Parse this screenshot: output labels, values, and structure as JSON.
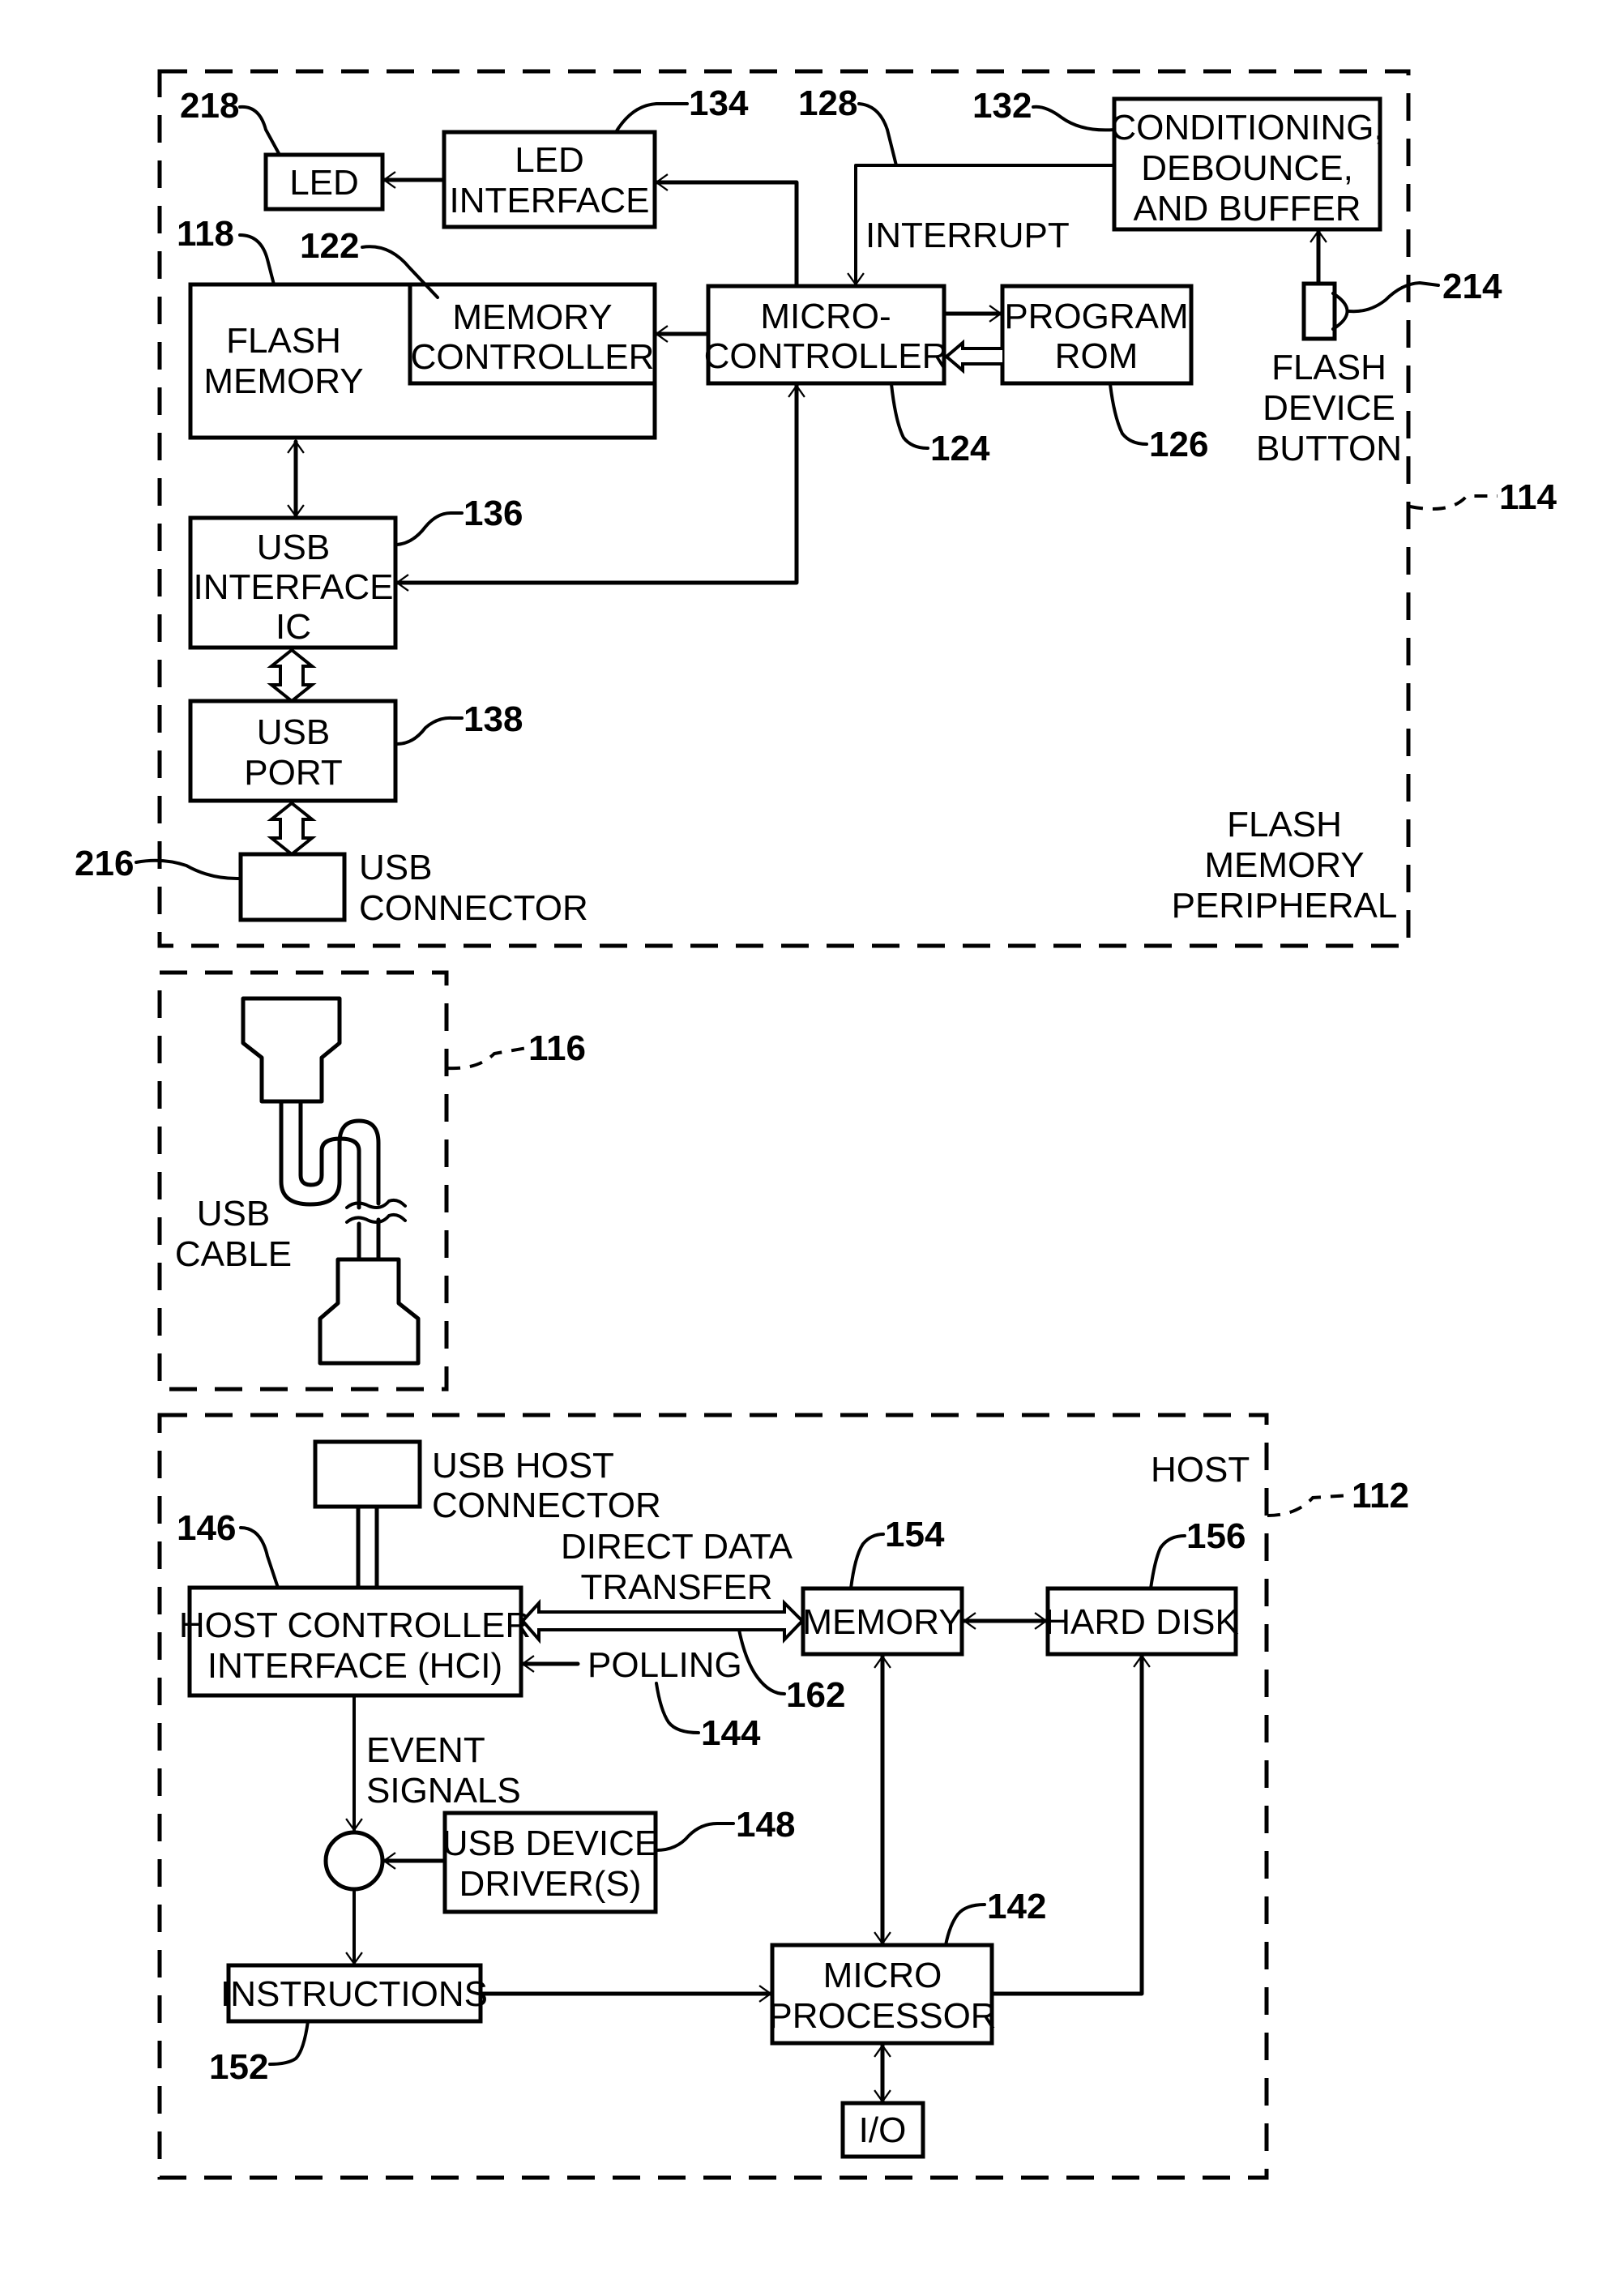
{
  "figure": {
    "flash_peripheral": {
      "ref": "114",
      "caption": [
        "FLASH",
        "MEMORY",
        "PERIPHERAL"
      ],
      "led": {
        "ref": "218",
        "label": [
          "LED"
        ]
      },
      "led_interface": {
        "ref": "134",
        "label": [
          "LED",
          "INTERFACE"
        ]
      },
      "conditioning": {
        "ref": "132",
        "label": [
          "CONDITIONING,",
          "DEBOUNCE,",
          "AND BUFFER"
        ]
      },
      "interrupt": {
        "ref": "128",
        "label": "INTERRUPT"
      },
      "flash_memory": {
        "ref": "118",
        "label": [
          "FLASH",
          "MEMORY"
        ]
      },
      "memory_controller": {
        "ref": "122",
        "label": [
          "MEMORY",
          "CONTROLLER"
        ]
      },
      "microcontroller": {
        "ref": "124",
        "label": [
          "MICRO-",
          "CONTROLLER"
        ]
      },
      "program_rom": {
        "ref": "126",
        "label": [
          "PROGRAM",
          "ROM"
        ]
      },
      "flash_device_button": {
        "ref": "214",
        "label": [
          "FLASH",
          "DEVICE",
          "BUTTON"
        ]
      },
      "usb_interface_ic": {
        "ref": "136",
        "label": [
          "USB",
          "INTERFACE",
          "IC"
        ]
      },
      "usb_port": {
        "ref": "138",
        "label": [
          "USB",
          "PORT"
        ]
      },
      "usb_connector": {
        "ref": "216",
        "label": [
          "USB",
          "CONNECTOR"
        ]
      }
    },
    "usb_cable": {
      "ref": "116",
      "label": [
        "USB",
        "CABLE"
      ]
    },
    "host": {
      "ref": "112",
      "caption": "HOST",
      "usb_host_connector": {
        "label": [
          "USB HOST",
          "CONNECTOR"
        ]
      },
      "hci": {
        "ref": "146",
        "label": [
          "HOST CONTROLLER",
          "INTERFACE  (HCI)"
        ]
      },
      "direct_data_transfer": {
        "ref": "162",
        "label": [
          "DIRECT DATA",
          "TRANSFER"
        ]
      },
      "polling": {
        "ref": "144",
        "label": "POLLING"
      },
      "memory": {
        "ref": "154",
        "label": [
          "MEMORY"
        ]
      },
      "hard_disk": {
        "ref": "156",
        "label": [
          "HARD DISK"
        ]
      },
      "event_signals": {
        "label": [
          "EVENT",
          "SIGNALS"
        ]
      },
      "usb_device_drivers": {
        "ref": "148",
        "label": [
          "USB DEVICE",
          "DRIVER(S)"
        ]
      },
      "instructions": {
        "ref": "152",
        "label": [
          "INSTRUCTIONS"
        ]
      },
      "microprocessor": {
        "ref": "142",
        "label": [
          "MICRO",
          "PROCESSOR"
        ]
      },
      "io": {
        "label": [
          "I/O"
        ]
      }
    }
  }
}
